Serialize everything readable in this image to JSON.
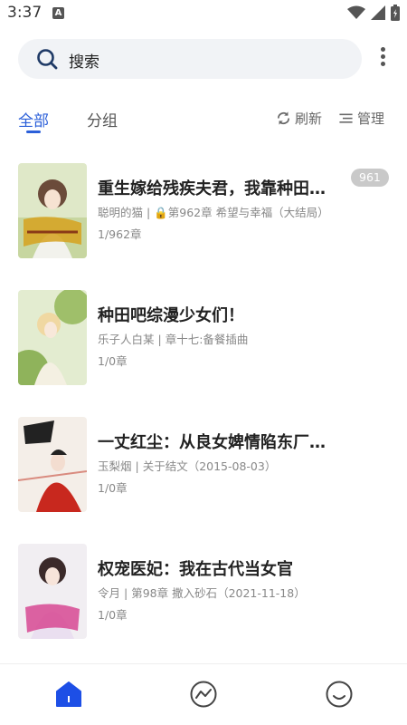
{
  "status_bar": {
    "time": "3:37",
    "notification_letter": "A"
  },
  "search": {
    "label": "搜索"
  },
  "tabs": [
    {
      "label": "全部",
      "active": true
    },
    {
      "label": "分组",
      "active": false
    }
  ],
  "actions": {
    "refresh": "刷新",
    "manage": "管理"
  },
  "colors": {
    "accent": "#2b5fd9",
    "text": "#222222",
    "muted": "#888888",
    "badge": "#c9c9c9"
  },
  "books": [
    {
      "title": "重生嫁给残疾夫君，我靠种田暴富",
      "author": "聪明的猫",
      "chapter": "🔒第962章 希望与幸福（大结局）",
      "progress": "1/962章",
      "badge": "961"
    },
    {
      "title": "种田吧综漫少女们！",
      "author": "乐子人白某",
      "chapter": "章十七:备餐插曲",
      "progress": "1/0章"
    },
    {
      "title": "一丈红尘：从良女婢情陷东厂主公",
      "author": "玉梨烟",
      "chapter": "关于结文（2015-08-03）",
      "progress": "1/0章"
    },
    {
      "title": "权宠医妃：我在古代当女官",
      "author": "令月",
      "chapter": "第98章 撒入砂石（2021-11-18）",
      "progress": "1/0章"
    }
  ],
  "bottom_nav": [
    {
      "icon": "home-icon",
      "active": true
    },
    {
      "icon": "explore-icon",
      "active": false
    },
    {
      "icon": "profile-icon",
      "active": false
    }
  ]
}
